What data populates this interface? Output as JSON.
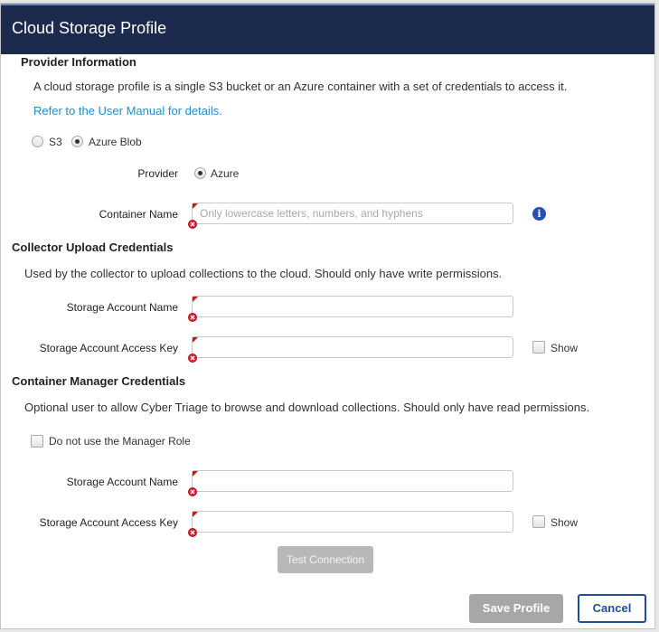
{
  "window": {
    "title": "Cloud Storage Profile"
  },
  "provider": {
    "heading": "Provider Information",
    "description": "A cloud storage profile is a single S3 bucket or an Azure container with a set of credentials to access it.",
    "manual_link": "Refer to the User Manual for details.",
    "type_options": [
      {
        "label": "S3",
        "selected": false
      },
      {
        "label": "Azure Blob",
        "selected": true
      }
    ],
    "provider_label": "Provider",
    "provider_option": "Azure",
    "container_label": "Container Name",
    "container_value": "",
    "container_placeholder": "Only lowercase letters, numbers, and hyphens",
    "info_glyph": "i"
  },
  "collector": {
    "heading": "Collector Upload Credentials",
    "description": "Used by the collector to upload collections to the cloud. Should only have write permissions.",
    "account_name_label": "Storage Account Name",
    "account_name_value": "",
    "access_key_label": "Storage Account Access Key",
    "access_key_value": "",
    "show_label": "Show"
  },
  "manager": {
    "heading": "Container Manager Credentials",
    "description": "Optional user to allow Cyber Triage to browse and download collections. Should only have read permissions.",
    "no_manager_label": "Do not use the Manager Role",
    "account_name_label": "Storage Account Name",
    "account_name_value": "",
    "access_key_label": "Storage Account Access Key",
    "access_key_value": "",
    "show_label": "Show"
  },
  "buttons": {
    "test": "Test Connection",
    "save": "Save Profile",
    "cancel": "Cancel"
  }
}
